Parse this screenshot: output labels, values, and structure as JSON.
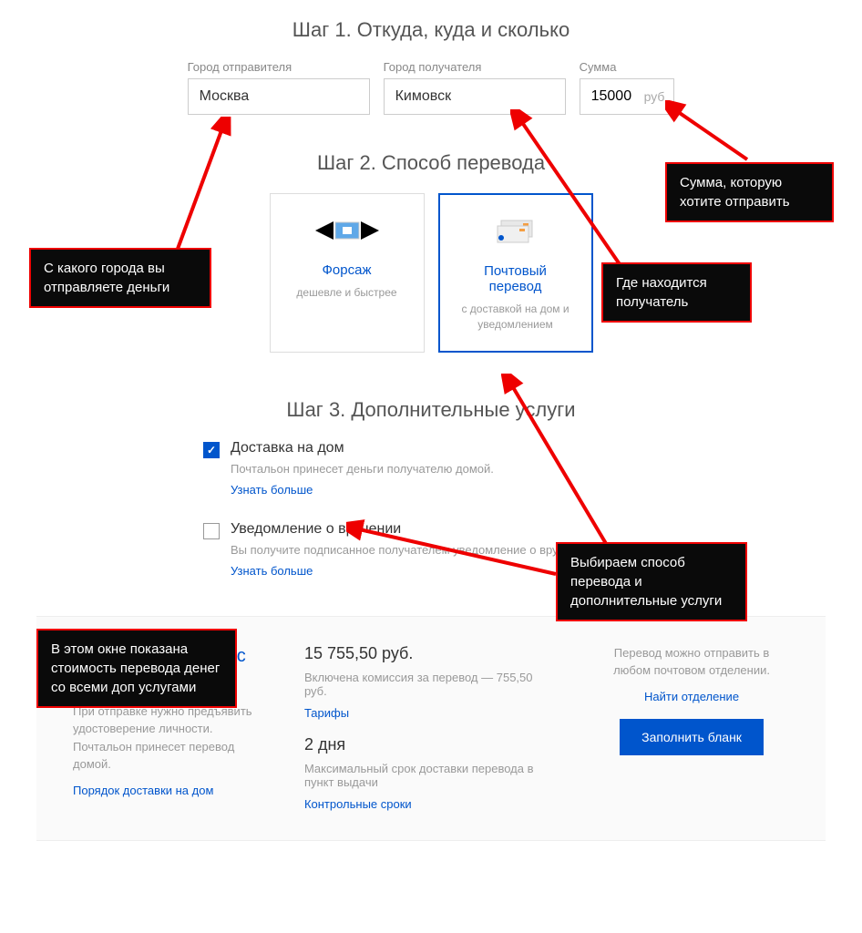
{
  "step1": {
    "title": "Шаг 1. Откуда, куда и сколько",
    "from_label": "Город отправителя",
    "from_value": "Москва",
    "to_label": "Город получателя",
    "to_value": "Кимовск",
    "amount_label": "Сумма",
    "amount_value": "15000",
    "amount_unit": "руб"
  },
  "step2": {
    "title": "Шаг 2. Способ перевода",
    "card1_title": "Форсаж",
    "card1_sub": "дешевле и быстрее",
    "card2_title": "Почтовый перевод",
    "card2_sub": "с доставкой на дом и уведомлением"
  },
  "step3": {
    "title": "Шаг 3. Дополнительные услуги",
    "opt1_title": "Доставка на дом",
    "opt1_desc": "Почтальон принесет деньги получателю домой.",
    "opt1_link": "Узнать больше",
    "opt2_title": "Уведомление о вручении",
    "opt2_desc": "Вы получите подписанное получателем уведомление о вручении",
    "opt2_link": "Узнать больше"
  },
  "summary": {
    "title": "Почтовый перевод с доставкой на дом",
    "desc": "При отправке нужно предъявить удостоверение личности. Почтальон принесет перевод домой.",
    "left_link": "Порядок доставки на дом",
    "price": "15 755,50 руб.",
    "price_note": "Включена комиссия за перевод — 755,50  руб.",
    "tariff_link": "Тарифы",
    "days": "2 дня",
    "days_note": "Максимальный срок доставки перевода в пункт выдачи",
    "days_link": "Контрольные сроки",
    "right_text": "Перевод можно отправить в любом почтовом отделении.",
    "right_link": "Найти отделение",
    "button": "Заполнить бланк"
  },
  "callouts": {
    "c1": "Сумма, которую хотите отправить",
    "c2": "С какого города вы отправляете деньги",
    "c3": "Где находится получатель",
    "c4": "Выбираем способ перевода и дополнительные услуги",
    "c5": "В этом окне показана стоимость перевода денег со всеми доп услугами"
  }
}
